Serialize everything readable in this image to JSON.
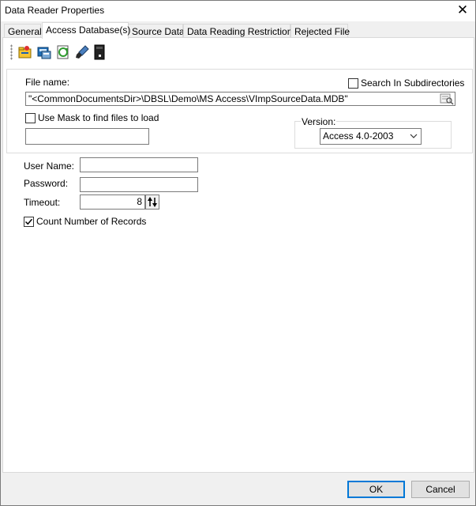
{
  "window": {
    "title": "Data Reader Properties",
    "close_icon": "close-icon"
  },
  "tabs": [
    {
      "label": "General"
    },
    {
      "label": "Access Database(s)"
    },
    {
      "label": "Source Data"
    },
    {
      "label": "Data Reading Restrictions"
    },
    {
      "label": "Rejected File"
    }
  ],
  "active_tab": "Access Database(s)",
  "toolbar": {
    "icons": [
      "open-folder-icon",
      "database-icon",
      "refresh-icon",
      "brush-icon",
      "file-dark-icon"
    ]
  },
  "file": {
    "label": "File name:",
    "value": "\"<CommonDocumentsDir>\\DBSL\\Demo\\MS Access\\VImpSourceData.MDB\"",
    "browse_icon": "browse-icon"
  },
  "search_subdirs": {
    "label": "Search In Subdirectories",
    "checked": false
  },
  "use_mask": {
    "label": "Use Mask to find files to load",
    "checked": false,
    "value": ""
  },
  "version": {
    "label": "Version:",
    "selected": "Access 4.0-2003"
  },
  "user_name": {
    "label": "User Name:",
    "value": ""
  },
  "password": {
    "label": "Password:",
    "value": ""
  },
  "timeout": {
    "label": "Timeout:",
    "value": "8"
  },
  "count_records": {
    "label": "Count Number of Records",
    "checked": true
  },
  "buttons": {
    "ok": "OK",
    "cancel": "Cancel"
  }
}
